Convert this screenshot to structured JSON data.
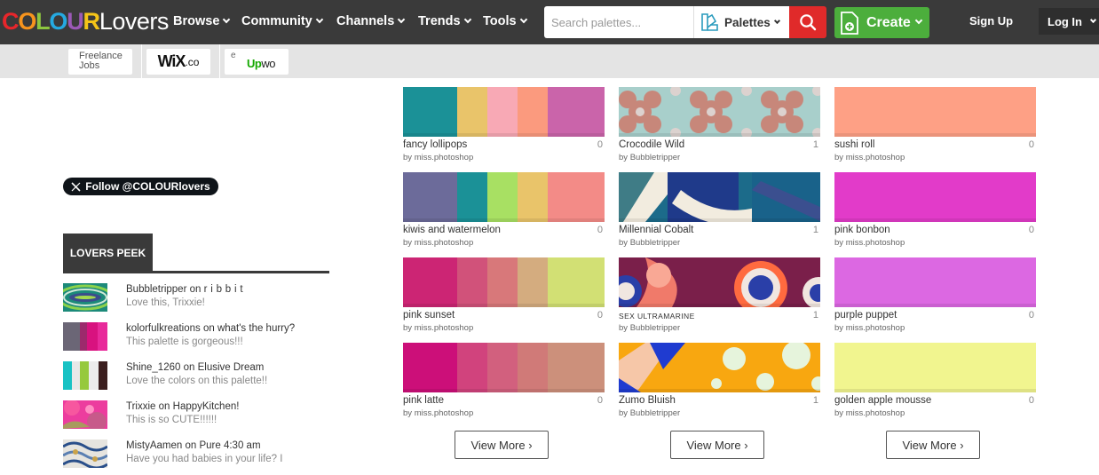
{
  "brand": {
    "logo_colour": "COLOUR",
    "logo_lovers": "Lovers",
    "logo_letter_colors": [
      "#e8262b",
      "#f7941d",
      "#8dc63f",
      "#25aae1",
      "#9b59b6",
      "#f5c518"
    ]
  },
  "nav": {
    "items": [
      {
        "label": "Browse"
      },
      {
        "label": "Community"
      },
      {
        "label": "Channels"
      },
      {
        "label": "Trends"
      },
      {
        "label": "Tools"
      }
    ],
    "search_placeholder": "Search palettes...",
    "search_type": "Palettes",
    "create_label": "Create",
    "signup_label": "Sign Up",
    "login_label": "Log In"
  },
  "ads": {
    "freelance_line1": "Freelance",
    "freelance_line2": "Jobs",
    "wix": "WiX",
    "wix_suffix": ".co",
    "upwork_e": "e",
    "upwork_up": "Up",
    "upwork_wo": "wo"
  },
  "sidebar": {
    "follow_label": "Follow @COLOURlovers",
    "peek_label": "LOVERS PEEK",
    "peek_items": [
      {
        "user": "Bubbletripper",
        "on": "on",
        "target": "r i b b i t",
        "comment": "Love this, Trixxie!"
      },
      {
        "user": "kolorfulkreations",
        "on": "on",
        "target": "what's the hurry?",
        "comment": "This palette is gorgeous!!!"
      },
      {
        "user": "Shine_1260",
        "on": "on",
        "target": "Elusive Dream",
        "comment": "Love the colors on this palette!!"
      },
      {
        "user": "Trixxie",
        "on": "on",
        "target": "HappyKitchen!",
        "comment": "This is so CUTE!!!!!!"
      },
      {
        "user": "MistyAamen",
        "on": "on",
        "target": "Pure 4:30 am",
        "comment": "Have you had babies in your life? I"
      }
    ]
  },
  "columns": [
    {
      "cards": [
        {
          "title": "fancy lollipops",
          "count": "0",
          "by": "by",
          "author": "miss.photoshop",
          "colors": [
            "#1b9197",
            "#e9c46a",
            "#f8a9b5",
            "#fb9a7e",
            "#ca64aa"
          ]
        },
        {
          "title": "kiwis and watermelon",
          "count": "0",
          "by": "by",
          "author": "miss.photoshop",
          "colors": [
            "#6c6b9a",
            "#1b9197",
            "#a8e063",
            "#e9c46a",
            "#f38b87"
          ]
        },
        {
          "title": "pink sunset",
          "count": "0",
          "by": "by",
          "author": "miss.photoshop",
          "colors": [
            "#cc2574",
            "#d1527a",
            "#d8787a",
            "#d4ac7f",
            "#d2e074"
          ]
        },
        {
          "title": "pink latte",
          "count": "0",
          "by": "by",
          "author": "miss.photoshop",
          "colors": [
            "#cc0f79",
            "#d1437d",
            "#d2607e",
            "#d07a78",
            "#cc907b"
          ]
        }
      ],
      "view_more": "View More ›"
    },
    {
      "cards": [
        {
          "title": "Crocodile Wild",
          "count": "1",
          "by": "by",
          "author": "Bubbletripper",
          "pattern": "flower"
        },
        {
          "title": "Millennial Cobalt",
          "count": "1",
          "by": "by",
          "author": "Bubbletripper",
          "pattern": "cobalt"
        },
        {
          "title": "SEX ULTRAMARINE",
          "count": "1",
          "by": "by",
          "author": "Bubbletripper",
          "pattern": "ultramarine"
        },
        {
          "title": "Zumo Bluish",
          "count": "1",
          "by": "by",
          "author": "Bubbletripper",
          "pattern": "zumo"
        }
      ],
      "view_more": "View More ›"
    },
    {
      "cards": [
        {
          "title": "sushi roll",
          "count": "0",
          "by": "by",
          "author": "miss.photoshop",
          "colors": [
            "#fea085"
          ]
        },
        {
          "title": "pink bonbon",
          "count": "0",
          "by": "by",
          "author": "miss.photoshop",
          "colors": [
            "#e23bc9"
          ]
        },
        {
          "title": "purple puppet",
          "count": "0",
          "by": "by",
          "author": "miss.photoshop",
          "colors": [
            "#dc68e2"
          ]
        },
        {
          "title": "golden apple mousse",
          "count": "0",
          "by": "by",
          "author": "miss.photoshop",
          "colors": [
            "#f1f58f"
          ]
        }
      ],
      "view_more": "View More ›"
    }
  ],
  "icons": {
    "search": "search-icon",
    "create": "create-file-icon",
    "palettes": "palettes-icon",
    "x_logo": "x-logo-icon"
  }
}
